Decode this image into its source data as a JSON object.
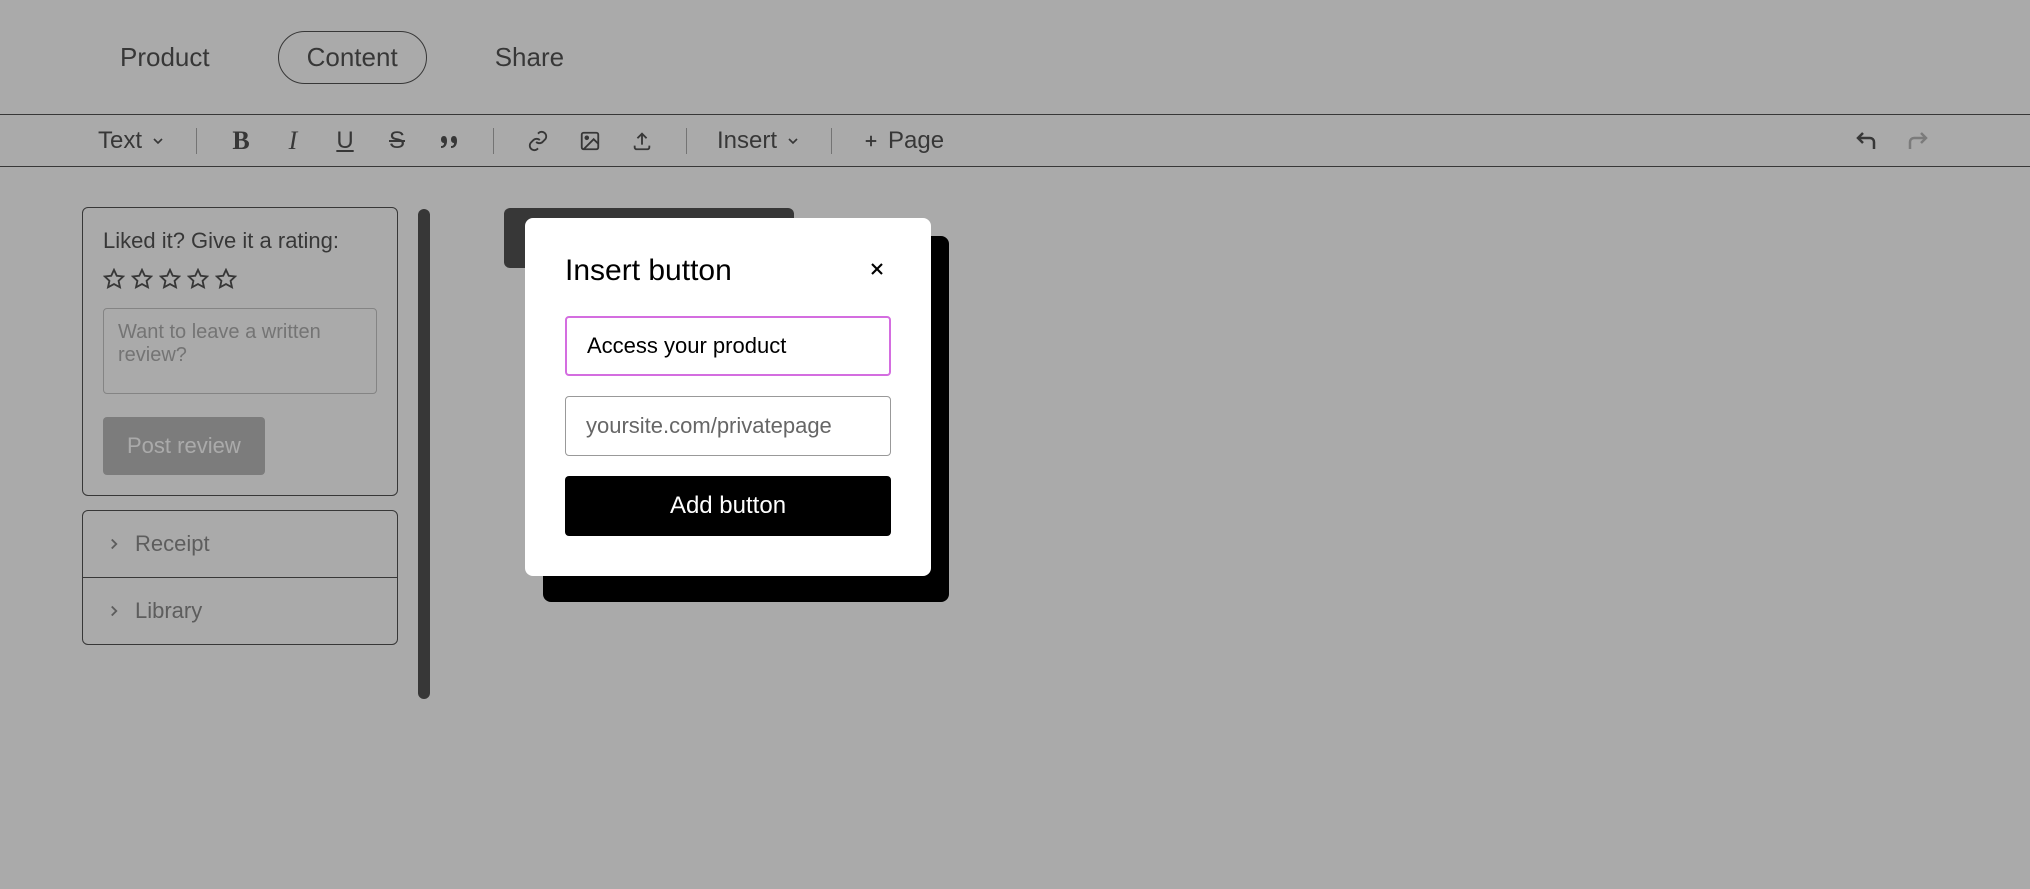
{
  "topbar": {
    "tabs": [
      {
        "label": "Product"
      },
      {
        "label": "Content"
      },
      {
        "label": "Share"
      }
    ]
  },
  "toolbar": {
    "text_label": "Text",
    "insert_label": "Insert",
    "page_label": "Page"
  },
  "rating": {
    "title": "Liked it? Give it a rating:",
    "placeholder": "Want to leave a written review?",
    "post_label": "Post review"
  },
  "collapse": {
    "items": [
      {
        "label": "Receipt"
      },
      {
        "label": "Library"
      }
    ]
  },
  "modal": {
    "title": "Insert button",
    "label_value": "Access your product",
    "url_placeholder": "yoursite.com/privatepage",
    "submit_label": "Add button"
  }
}
